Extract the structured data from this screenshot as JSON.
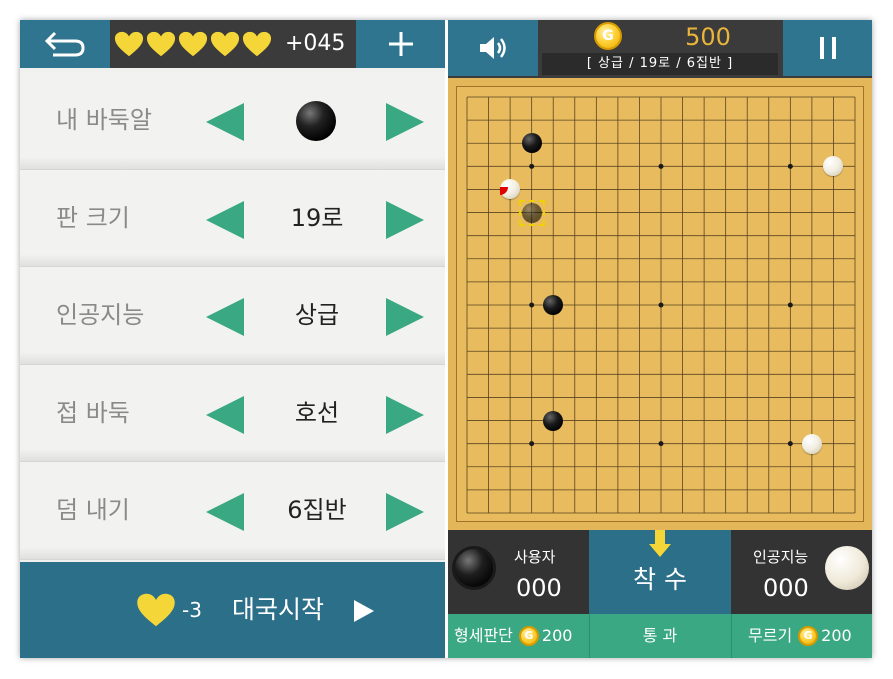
{
  "header": {
    "hearts_count": 5,
    "lives_text": "+045"
  },
  "settings": {
    "rows": [
      {
        "label": "내 바둑알",
        "value": "",
        "stone": "black"
      },
      {
        "label": "판 크기",
        "value": "19로"
      },
      {
        "label": "인공지능",
        "value": "상급"
      },
      {
        "label": "접 바둑",
        "value": "호선"
      },
      {
        "label": "덤 내기",
        "value": "6집반"
      }
    ]
  },
  "start": {
    "cost": "-3",
    "label": "대국시작"
  },
  "game": {
    "coins": "500",
    "coin_symbol": "G",
    "info": "[  상급  /  19로  /  6집반  ]",
    "board_size": 19,
    "stones": [
      {
        "color": "black",
        "col": 3,
        "row": 2
      },
      {
        "color": "white",
        "col": 17,
        "row": 3
      },
      {
        "color": "white",
        "col": 2,
        "row": 4,
        "last_move": true
      },
      {
        "color": "black",
        "col": 3,
        "row": 5,
        "hint": true
      },
      {
        "color": "black",
        "col": 4,
        "row": 9
      },
      {
        "color": "black",
        "col": 4,
        "row": 14
      },
      {
        "color": "white",
        "col": 16,
        "row": 15
      }
    ],
    "hoshi": [
      [
        3,
        3
      ],
      [
        9,
        3
      ],
      [
        15,
        3
      ],
      [
        3,
        9
      ],
      [
        9,
        9
      ],
      [
        15,
        9
      ],
      [
        3,
        15
      ],
      [
        9,
        15
      ],
      [
        15,
        15
      ]
    ]
  },
  "players": {
    "user": {
      "name": "사용자",
      "score": "000",
      "stone": "black"
    },
    "ai": {
      "name": "인공지능",
      "score": "000",
      "stone": "white"
    }
  },
  "move_button": {
    "label": "착 수"
  },
  "actions": {
    "evaluate": {
      "label": "형세판단",
      "cost": "200"
    },
    "pass": {
      "label": "통 과"
    },
    "undo": {
      "label": "무르기",
      "cost": "200"
    }
  },
  "colors": {
    "accent_blue": "#2f7590",
    "accent_green": "#3aa882",
    "coin_gold": "#e8b43a",
    "heart_yellow": "#f5d638",
    "board": "#e8bc5e"
  }
}
